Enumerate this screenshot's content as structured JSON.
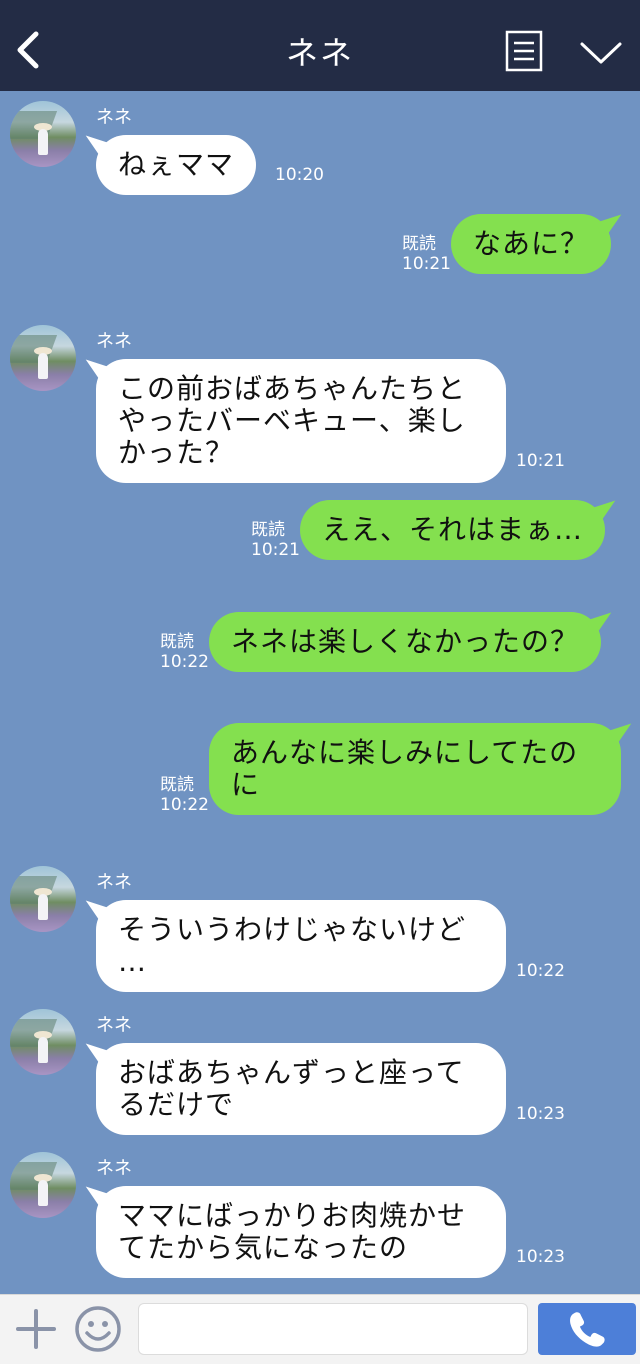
{
  "header": {
    "title": "ネネ",
    "back_icon": "chevron-left-icon",
    "menu_icon": "menu-icon",
    "collapse_icon": "chevron-down-icon"
  },
  "messages": [
    {
      "side": "in",
      "sender": "ネネ",
      "text": "ねぇママ",
      "time": "10:20"
    },
    {
      "side": "out",
      "read": "既読",
      "text": "なあに？",
      "time": "10:21"
    },
    {
      "side": "in",
      "sender": "ネネ",
      "text": "この前おばあちゃんたちと\nやったバーベキュー、楽し\nかった？",
      "time": "10:21"
    },
    {
      "side": "out",
      "read": "既読",
      "text": "ええ、それはまぁ…",
      "time": "10:21"
    },
    {
      "side": "out",
      "read": "既読",
      "text": "ネネは楽しくなかったの？",
      "time": "10:22"
    },
    {
      "side": "out",
      "read": "既読",
      "text": "あんなに楽しみにしてたの\nに",
      "time": "10:22"
    },
    {
      "side": "in",
      "sender": "ネネ",
      "text": "そういうわけじゃないけど\n…",
      "time": "10:22"
    },
    {
      "side": "in",
      "sender": "ネネ",
      "text": "おばあちゃんずっと座って\nるだけで",
      "time": "10:23"
    },
    {
      "side": "in",
      "sender": "ネネ",
      "text": "ママにばっかりお肉焼かせ\nてたから気になったの",
      "time": "10:23"
    }
  ],
  "footer": {
    "plus_icon": "plus-icon",
    "emoji_icon": "smiley-icon",
    "input_placeholder": "",
    "call_icon": "phone-icon"
  },
  "colors": {
    "header_bg": "#232c45",
    "chat_bg": "#7093c2",
    "incoming_bubble": "#ffffff",
    "outgoing_bubble": "#84e04f",
    "call_button": "#4d7fd8"
  }
}
